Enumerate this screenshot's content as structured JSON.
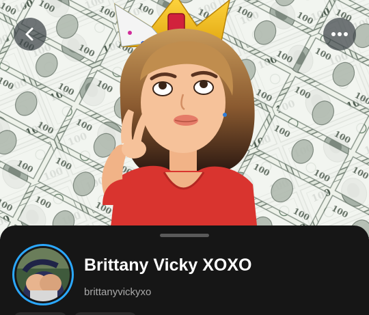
{
  "profile": {
    "display_name": "Brittany Vicky XOXO",
    "username": "brittanyvickyxo",
    "story_ring_color": "#2ba8ff"
  },
  "nav": {
    "back_icon": "chevron-left-icon",
    "more_icon": "more-horizontal-icon"
  },
  "theme": {
    "sheet_background": "#161616",
    "name_color": "#ffffff",
    "username_color": "#a9a9a9"
  }
}
